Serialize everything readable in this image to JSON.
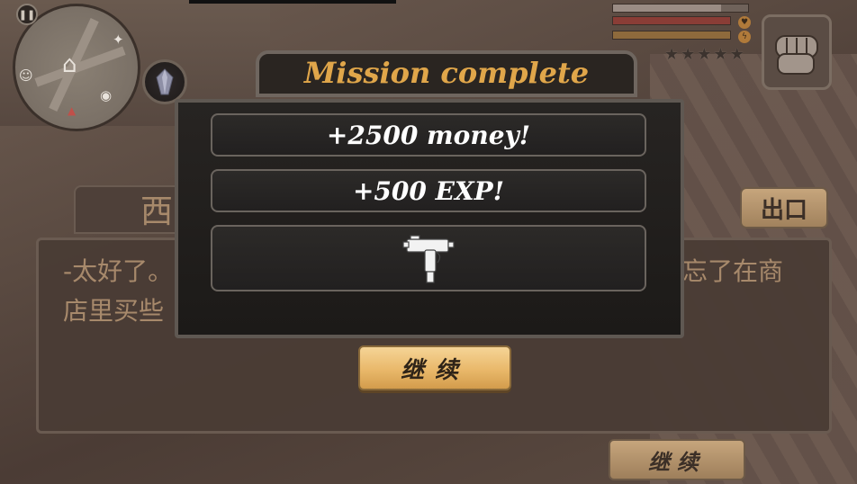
{
  "hud": {
    "pause_icon": "pause-icon",
    "minimap": {
      "glyphs": [
        {
          "name": "home-icon",
          "glyph": "⌂"
        },
        {
          "name": "target-icon",
          "glyph": "✦"
        },
        {
          "name": "player-icon",
          "glyph": "◉"
        },
        {
          "name": "person-icon",
          "glyph": "☺"
        },
        {
          "name": "flag-icon",
          "glyph": "▲"
        }
      ]
    },
    "wanted_stars": 5,
    "colors": {
      "health": "#9a8c84",
      "armor": "#8a3d36",
      "stamina": "#8e6a3c"
    }
  },
  "dialogue": {
    "speaker_name": "西",
    "line_a": "-太好了。",
    "line_b": "忘了在商",
    "line_c": "店里买些",
    "exit_label": "出口",
    "continue_label": "继续"
  },
  "mission": {
    "title": "Mission complete",
    "money_reward": "+2500 money!",
    "exp_reward": "+500 EXP!",
    "weapon_icon": "uzi-icon",
    "continue_label": "继续"
  }
}
